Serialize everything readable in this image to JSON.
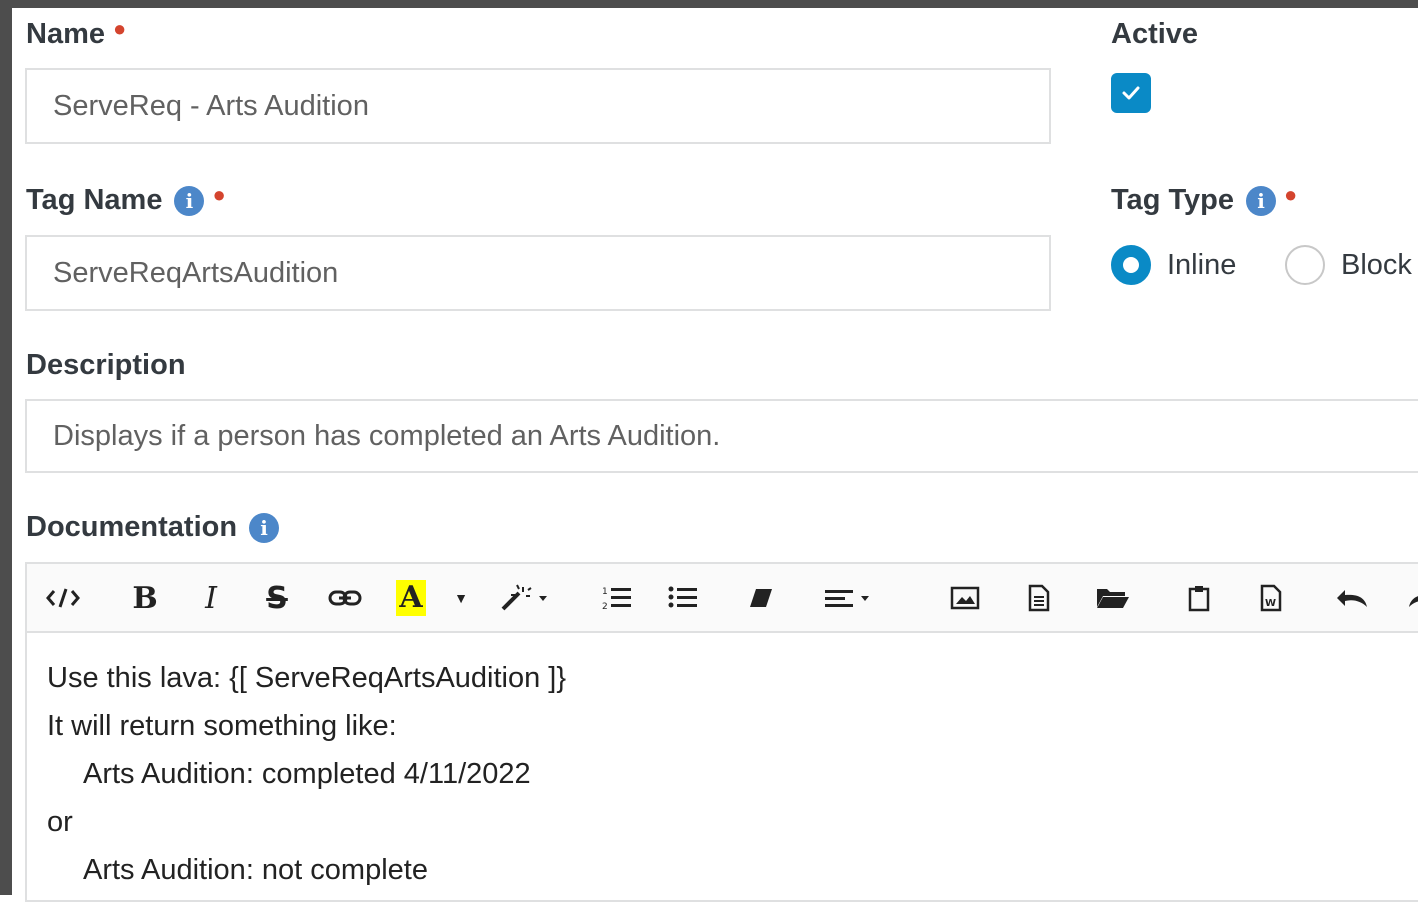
{
  "form": {
    "name": {
      "label": "Name",
      "value": "ServeReq - Arts Audition"
    },
    "active": {
      "label": "Active",
      "checked": true
    },
    "tag_name": {
      "label": "Tag Name",
      "value": "ServeReqArtsAudition"
    },
    "tag_type": {
      "label": "Tag Type",
      "options": [
        {
          "label": "Inline",
          "selected": true
        },
        {
          "label": "Block",
          "selected": false
        }
      ]
    },
    "description": {
      "label": "Description",
      "value": "Displays if a person has completed an Arts Audition."
    },
    "documentation": {
      "label": "Documentation",
      "toolbar": [
        "code-view-icon",
        "bold-icon",
        "italic-icon",
        "strikethrough-icon",
        "link-icon",
        "font-color-icon",
        "color-dropdown-icon",
        "magic-wand-icon",
        "ordered-list-icon",
        "unordered-list-icon",
        "eraser-icon",
        "align-icon",
        "image-icon",
        "file-icon",
        "folder-icon",
        "paste-icon",
        "paste-word-icon",
        "undo-icon",
        "redo-icon"
      ],
      "lines": [
        "Use this lava: {[ ServeReqArtsAudition ]}",
        "It will return something like:",
        "Arts Audition: completed 4/11/2022",
        "or",
        "Arts Audition: not complete"
      ]
    }
  },
  "colors": {
    "accent": "#0a8ac6",
    "required": "#d4442e",
    "info": "#4c87c9",
    "highlight": "#ffff00"
  }
}
